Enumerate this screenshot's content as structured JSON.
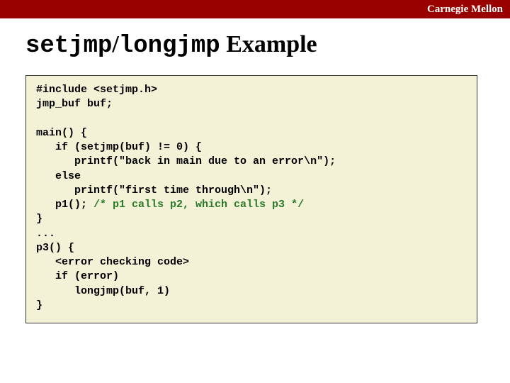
{
  "brand": "Carnegie Mellon",
  "title": {
    "code1": "setjmp",
    "sep": "/",
    "code2": "longjmp",
    "rest": " Example"
  },
  "code": {
    "l01": "#include <setjmp.h>",
    "l02": "jmp_buf buf;",
    "l03": "",
    "l04": "main() {",
    "l05": "   if (setjmp(buf) != 0) {",
    "l06": "      printf(\"back in main due to an error\\n\");",
    "l07": "   else",
    "l08": "      printf(\"first time through\\n\");",
    "l09a": "   p1(); ",
    "l09b": "/* p1 calls p2, which calls p3 */",
    "l10": "}",
    "l11": "...",
    "l12": "p3() {",
    "l13": "   <error checking code>",
    "l14": "   if (error)",
    "l15": "      longjmp(buf, 1)",
    "l16": "}"
  }
}
